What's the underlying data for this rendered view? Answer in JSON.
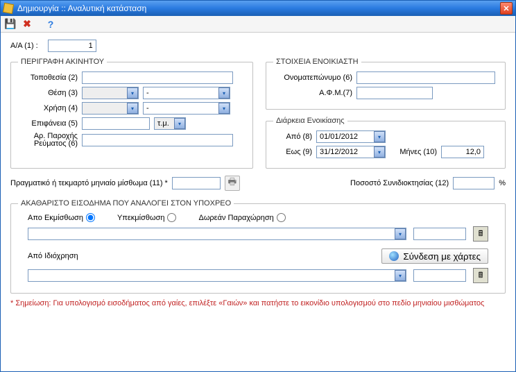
{
  "window": {
    "title": "Δημιουργία :: Αναλυτική κατάσταση"
  },
  "aa": {
    "label": "Α/Α (1) :",
    "value": "1"
  },
  "propertyDesc": {
    "legend": "ΠΕΡΙΓΡΑΦΗ ΑΚΙΝΗΤΟΥ",
    "location_label": "Τοποθεσία (2)",
    "position_label": "Θέση (3)",
    "position_desc": "-",
    "use_label": "Χρήση (4)",
    "use_desc": "-",
    "area_label": "Επιφάνεια (5)",
    "area_unit": "τ.μ.",
    "power_label1": "Αρ. Παροχής",
    "power_label2": "Ρεύματος (6)"
  },
  "tenant": {
    "legend": "ΣΤΟΙΧΕΙΑ ΕΝΟΙΚΙΑΣΤΗ",
    "fullname_label": "Ονοματεπώνυμο (6)",
    "afm_label": "Α.Φ.Μ.(7)"
  },
  "duration": {
    "legend": "Διάρκεια  Ενοικίασης",
    "from_label": "Από (8)",
    "from_value": "01/01/2012",
    "to_label": "Εως (9)",
    "to_value": "31/12/2012",
    "months_label": "Μήνες (10)",
    "months_value": "12,0"
  },
  "rent": {
    "label": "Πραγματικό ή τεκμαρτό μηνιαίο μίσθωμα (11) *"
  },
  "ownership": {
    "label": "Ποσοστό Συνιδιοκτησίας (12)",
    "unit": "%"
  },
  "grossIncome": {
    "legend": "ΑΚΑΘΑΡΙΣΤΟ ΕΙΣΟΔΗΜΑ ΠΟΥ ΑΝΑΛΟΓΕΙ ΣΤΟΝ ΥΠΟΧΡΕΟ",
    "opt_lease": "Απο Εκμίσθωση",
    "opt_sublease": "Υπεκμίσθωση",
    "opt_free": "Δωρεάν Παραχώρηση",
    "opt_ownuse": "Από Ιδιόχρηση",
    "maps_btn": "Σύνδεση με χάρτες"
  },
  "note": "* Σημείωση: Για υπολογισμό εισοδήματος από γαίες, επιλέξτε «Γαιών» και πατήστε το εικονίδιο υπολογισμού στο πεδίο μηνιαίου μισθώματος"
}
